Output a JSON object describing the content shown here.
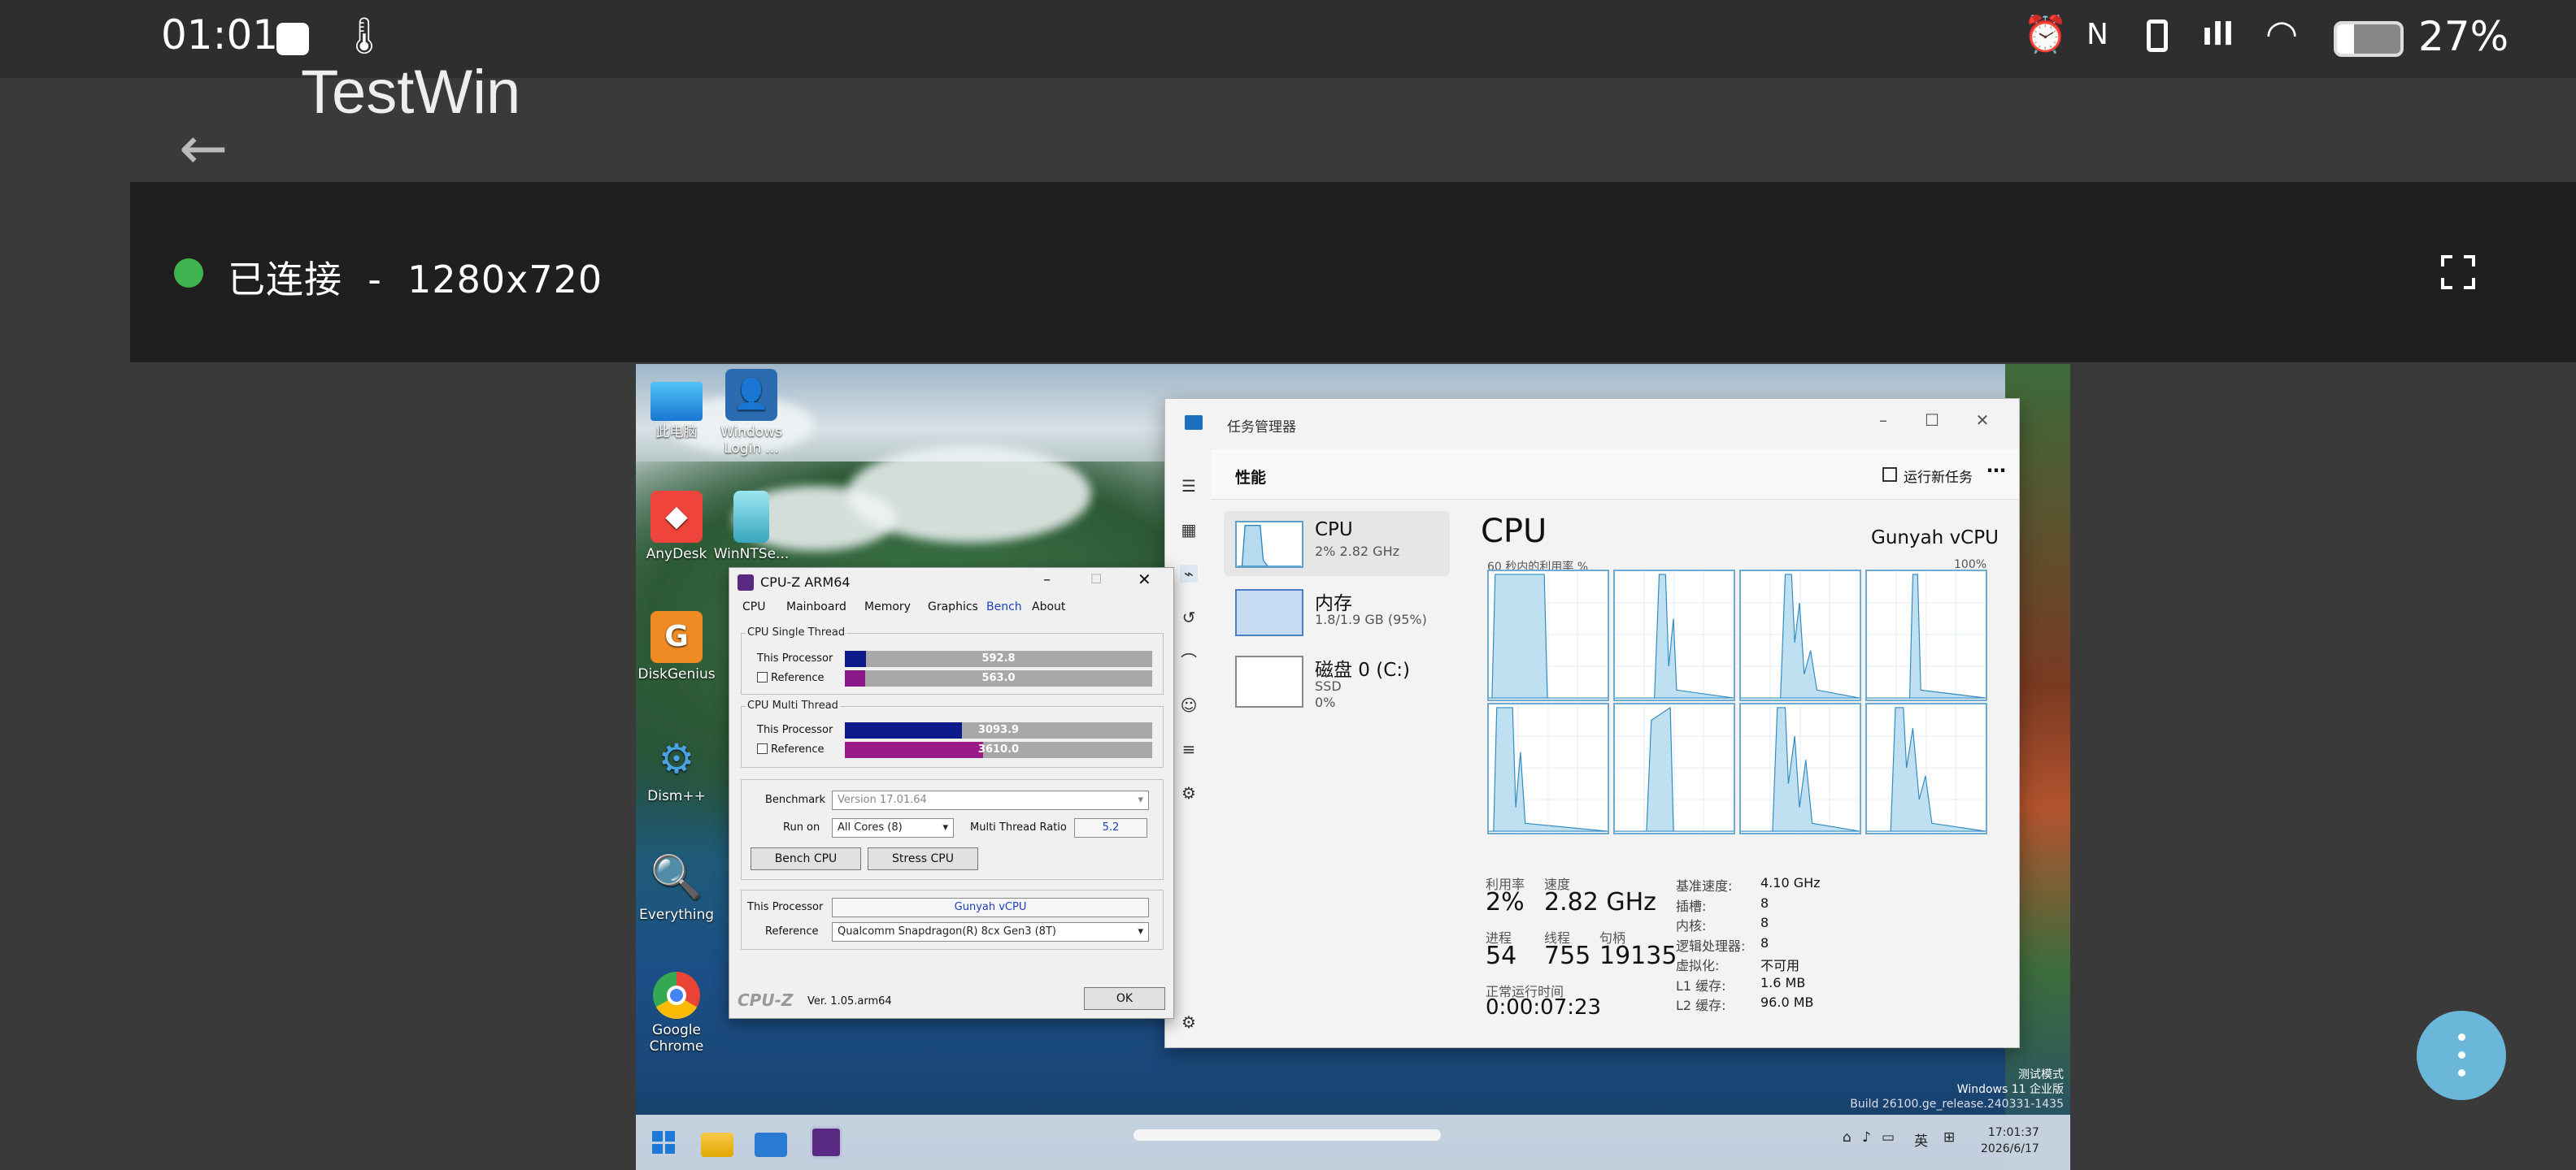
{
  "status_bar": {
    "time": "01:01",
    "battery": "27%"
  },
  "app_bar": {
    "title": "TestWin"
  },
  "connection": {
    "status": "已连接",
    "separator": "-",
    "resolution": "1280x720"
  },
  "desktop_icons": [
    {
      "label": "此电脑"
    },
    {
      "label": "Windows Login ..."
    },
    {
      "label": "AnyDesk"
    },
    {
      "label": "WinNTSe..."
    },
    {
      "label": "DiskGenius"
    },
    {
      "label": "Dism++"
    },
    {
      "label": "Everything"
    },
    {
      "label": "Google Chrome"
    }
  ],
  "task_manager": {
    "title": "任务管理器",
    "section": "性能",
    "run_new_task": "运行新任务",
    "sidebar": [
      {
        "name": "CPU",
        "sub": "2% 2.82 GHz"
      },
      {
        "name": "内存",
        "sub": "1.8/1.9 GB (95%)"
      },
      {
        "name": "磁盘 0 (C:)",
        "sub": "SSD",
        "sub2": "0%"
      }
    ],
    "heading": "CPU",
    "cpu_name": "Gunyah vCPU",
    "util_caption": "60 秒内的利用率 %",
    "pct_max": "100%",
    "stats": {
      "util_label": "利用率",
      "util": "2%",
      "speed_label": "速度",
      "speed": "2.82 GHz",
      "proc_label": "进程",
      "proc": "54",
      "thread_label": "线程",
      "thread": "755",
      "handle_label": "句柄",
      "handle": "19135",
      "uptime_label": "正常运行时间",
      "uptime": "0:00:07:23"
    },
    "info": [
      {
        "k": "基准速度:",
        "v": "4.10 GHz"
      },
      {
        "k": "插槽:",
        "v": "8"
      },
      {
        "k": "内核:",
        "v": "8"
      },
      {
        "k": "逻辑处理器:",
        "v": "8"
      },
      {
        "k": "虚拟化:",
        "v": "不可用"
      },
      {
        "k": "L1 缓存:",
        "v": "1.6 MB"
      },
      {
        "k": "L2 缓存:",
        "v": "96.0 MB"
      }
    ]
  },
  "cpuz": {
    "title": "CPU-Z ARM64",
    "tabs": [
      "CPU",
      "Mainboard",
      "Memory",
      "Graphics",
      "Bench",
      "About"
    ],
    "active_tab": "Bench",
    "single_group": "CPU Single Thread",
    "multi_group": "CPU Multi Thread",
    "this_processor_label": "This Processor",
    "reference_label": "Reference",
    "single": {
      "this": "592.8",
      "this_frac": 0.068,
      "ref": "563.0",
      "ref_frac": 0.065
    },
    "multi": {
      "this": "3093.9",
      "this_frac": 0.38,
      "ref": "3610.0",
      "ref_frac": 0.45
    },
    "benchmark_label": "Benchmark",
    "benchmark_value": "Version 17.01.64",
    "run_on_label": "Run on",
    "run_on_value": "All Cores (8)",
    "ratio_label": "Multi Thread Ratio",
    "ratio_value": "5.2",
    "bench_btn": "Bench CPU",
    "stress_btn": "Stress CPU",
    "this_proc_value": "Gunyah vCPU",
    "ref_value": "Qualcomm Snapdragon(R) 8cx Gen3 (8T)",
    "logo": "CPU-Z",
    "version": "Ver. 1.05.arm64",
    "ok": "OK"
  },
  "watermark": {
    "line1": "测试模式",
    "line2": "Windows 11 企业版",
    "line3": "Build 26100.ge_release.240331-1435"
  },
  "tray": {
    "lang": "英",
    "time": "17:01:37",
    "date": "2026/6/17"
  }
}
